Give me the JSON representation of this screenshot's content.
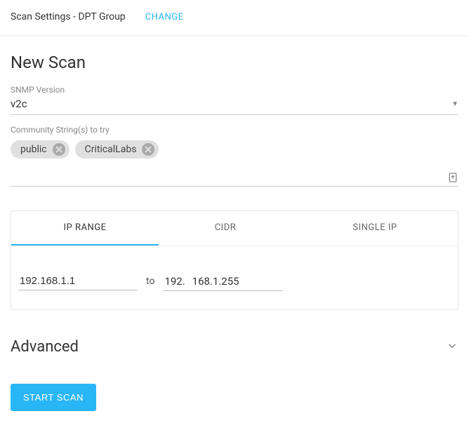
{
  "header": {
    "title": "Scan Settings - DPT Group",
    "change_label": "CHANGE"
  },
  "page": {
    "heading": "New Scan",
    "snmp_label": "SNMP Version",
    "snmp_value": "v2c",
    "community_label": "Community String(s) to try",
    "chips": [
      "public",
      "CriticalLabs"
    ]
  },
  "tabs": {
    "ip_range": "IP RANGE",
    "cidr": "CIDR",
    "single_ip": "SINGLE IP"
  },
  "ip": {
    "start": "192.168.1.1",
    "separator": "to",
    "end_prefix": "192.",
    "end_suffix": "168.1.255"
  },
  "advanced": {
    "label": "Advanced"
  },
  "actions": {
    "start_scan": "START SCAN"
  }
}
